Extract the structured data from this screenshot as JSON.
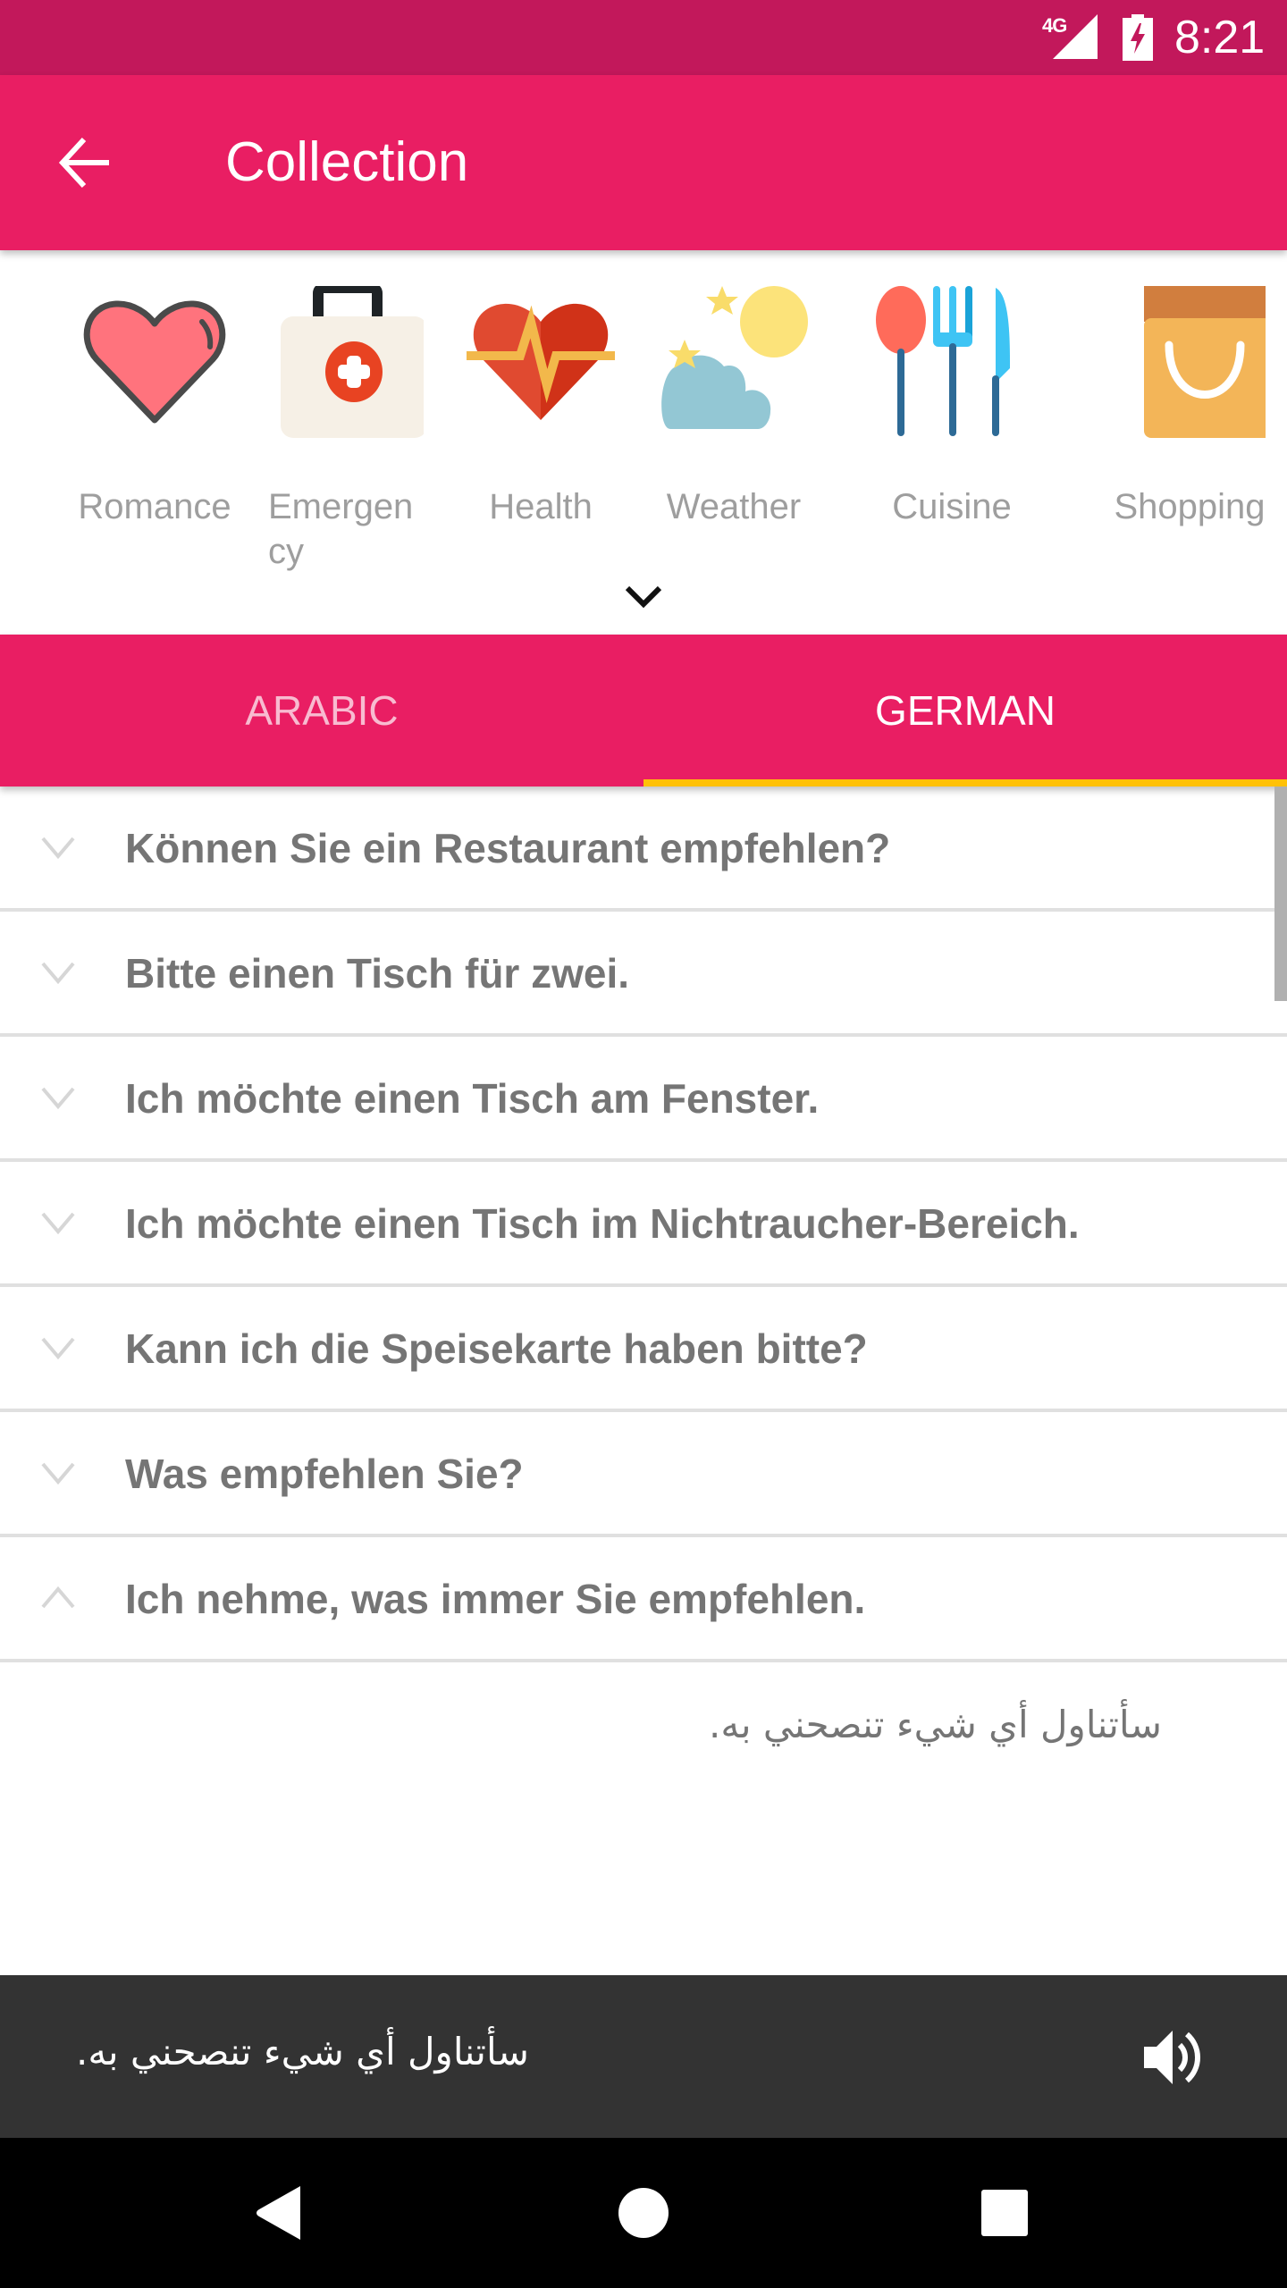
{
  "status_bar": {
    "network": "4G",
    "time": "8:21",
    "icons": [
      "signal-icon",
      "battery-charging-icon"
    ]
  },
  "toolbar": {
    "back_icon": "arrow-back-icon",
    "title": "Collection"
  },
  "categories": [
    {
      "label": "Romance",
      "icon": "heart-icon"
    },
    {
      "label": "Emergency",
      "display": "Emergen\ncy",
      "icon": "first-aid-kit-icon"
    },
    {
      "label": "Health",
      "icon": "heartbeat-icon"
    },
    {
      "label": "Weather",
      "icon": "cloud-moon-icon"
    },
    {
      "label": "Cuisine",
      "icon": "cutlery-icon"
    },
    {
      "label": "Shopping",
      "icon": "shopping-bag-icon"
    }
  ],
  "expand_icon": "chevron-down-icon",
  "tabs": [
    {
      "label": "ARABIC",
      "active": false
    },
    {
      "label": "GERMAN",
      "active": true
    }
  ],
  "colors": {
    "status_bar": "#C2185B",
    "primary": "#E91E63",
    "tab_indicator": "#FFC107",
    "row_text": "#757575",
    "player_bg": "#333333"
  },
  "phrases": [
    {
      "text": "Können Sie ein Restaurant empfehlen?",
      "expanded": false
    },
    {
      "text": "Bitte einen Tisch für zwei.",
      "expanded": false
    },
    {
      "text": "Ich möchte einen Tisch am Fenster.",
      "expanded": false
    },
    {
      "text": "Ich möchte einen Tisch im Nichtraucher-Bereich.",
      "expanded": false
    },
    {
      "text": "Kann ich die Speisekarte haben bitte?",
      "expanded": false
    },
    {
      "text": "Was empfehlen Sie?",
      "expanded": false
    },
    {
      "text": "Ich nehme, was immer Sie empfehlen.",
      "expanded": true,
      "translation": "سأتناول أي شيء تنصحني به."
    }
  ],
  "player": {
    "text": "سأتناول أي شيء تنصحني به.",
    "icon": "speaker-icon"
  },
  "nav_bar": {
    "buttons": [
      "back-nav-icon",
      "home-nav-icon",
      "recents-nav-icon"
    ]
  }
}
